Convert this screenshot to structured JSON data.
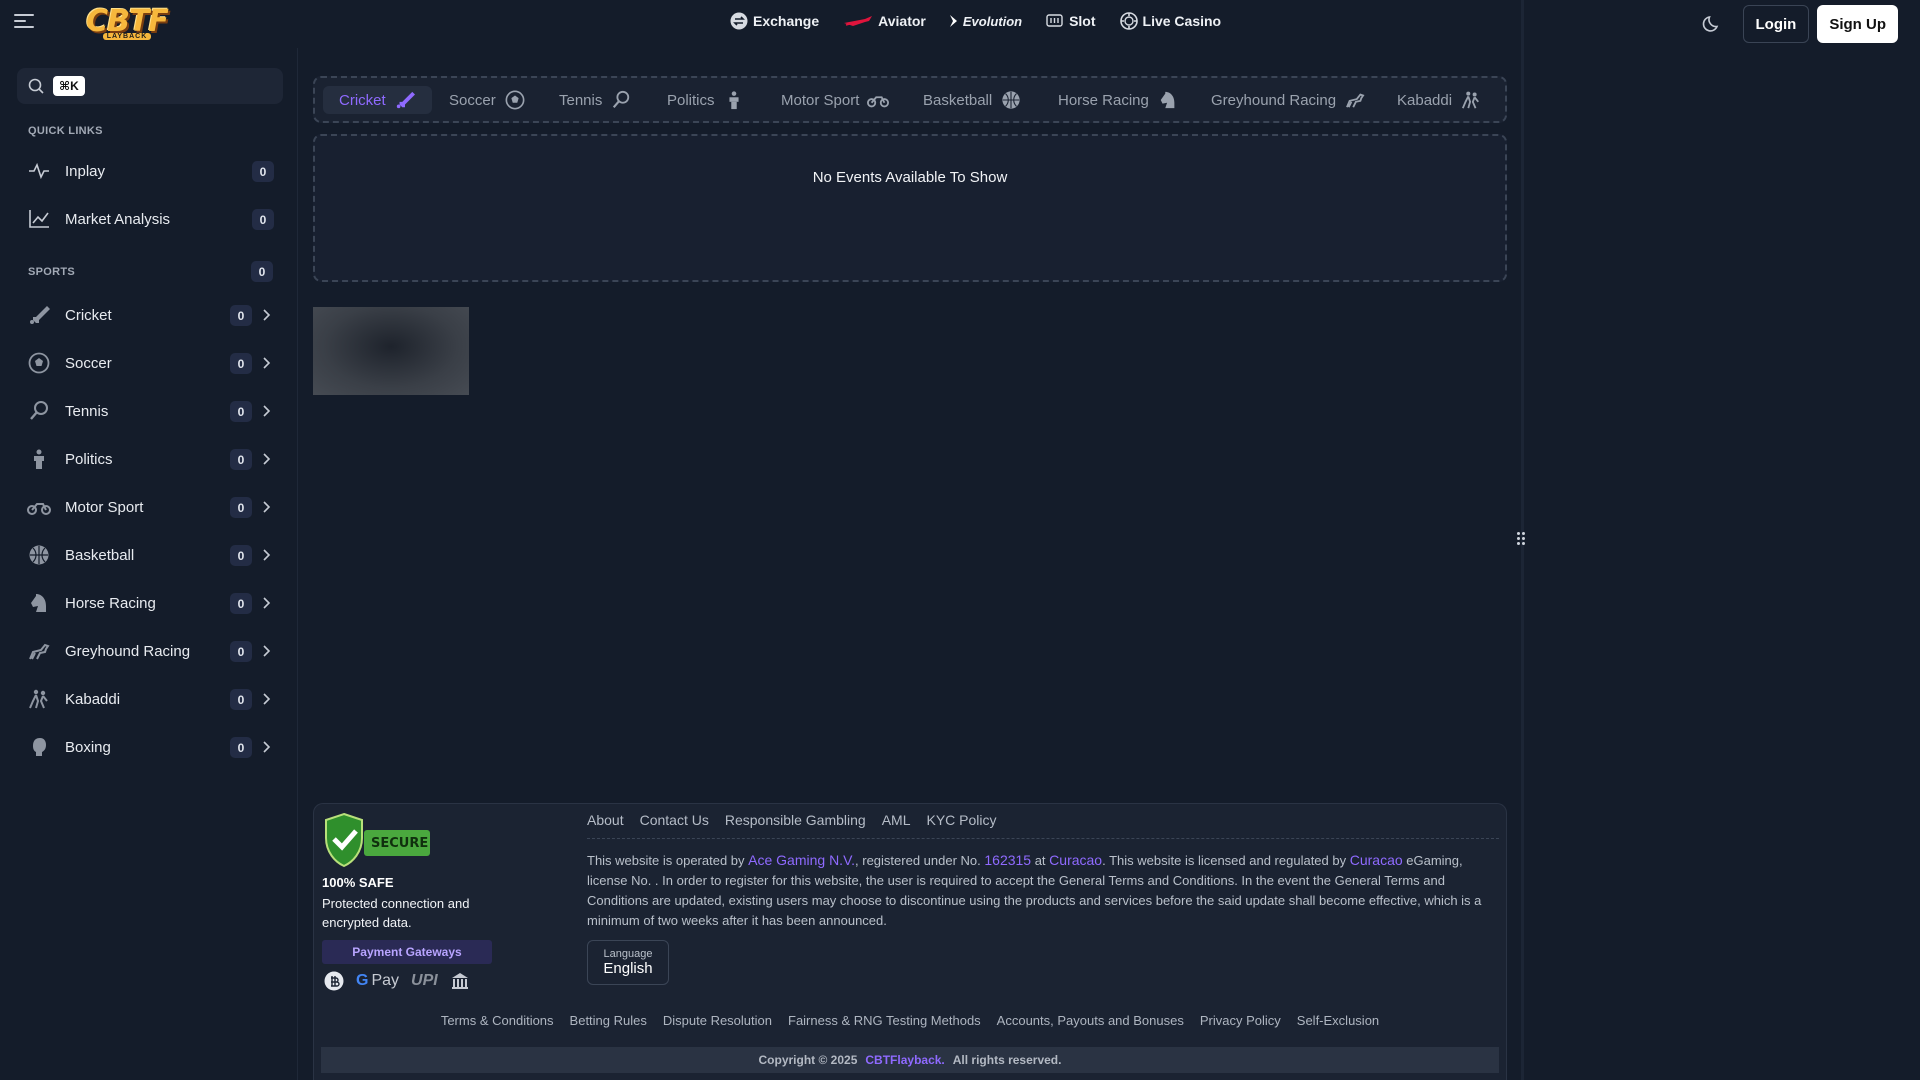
{
  "header": {
    "logo_text": "CBTF",
    "logo_sub": "LAYBACK",
    "nav": [
      {
        "label": "Exchange",
        "icon": "exchange-icon"
      },
      {
        "label": "Aviator",
        "icon": "aviator-plane-icon"
      },
      {
        "label": "Evolution",
        "icon": "evolution-icon"
      },
      {
        "label": "Slot",
        "icon": "slot-machine-icon"
      },
      {
        "label": "Live Casino",
        "icon": "casino-chip-icon"
      }
    ],
    "login_label": "Login",
    "signup_label": "Sign Up"
  },
  "sidebar": {
    "search_shortcut": "⌘K",
    "search_placeholder": "",
    "quick_links_label": "QUICK LINKS",
    "quick_links": [
      {
        "label": "Inplay",
        "count": "0",
        "icon": "pulse-icon"
      },
      {
        "label": "Market Analysis",
        "count": "0",
        "icon": "chart-line-icon"
      }
    ],
    "sports_label": "SPORTS",
    "sports_count": "0",
    "sports": [
      {
        "label": "Cricket",
        "count": "0",
        "icon": "cricket-bat-icon"
      },
      {
        "label": "Soccer",
        "count": "0",
        "icon": "soccer-ball-icon"
      },
      {
        "label": "Tennis",
        "count": "0",
        "icon": "tennis-racket-icon"
      },
      {
        "label": "Politics",
        "count": "0",
        "icon": "politics-podium-icon"
      },
      {
        "label": "Motor Sport",
        "count": "0",
        "icon": "motorbike-icon"
      },
      {
        "label": "Basketball",
        "count": "0",
        "icon": "basketball-icon"
      },
      {
        "label": "Horse Racing",
        "count": "0",
        "icon": "horse-head-icon"
      },
      {
        "label": "Greyhound Racing",
        "count": "0",
        "icon": "greyhound-icon"
      },
      {
        "label": "Kabaddi",
        "count": "0",
        "icon": "kabaddi-players-icon"
      },
      {
        "label": "Boxing",
        "count": "0",
        "icon": "boxing-glove-icon"
      }
    ]
  },
  "main": {
    "tabs": [
      {
        "label": "Cricket",
        "active": true
      },
      {
        "label": "Soccer"
      },
      {
        "label": "Tennis"
      },
      {
        "label": "Politics"
      },
      {
        "label": "Motor Sport"
      },
      {
        "label": "Basketball"
      },
      {
        "label": "Horse Racing"
      },
      {
        "label": "Greyhound Racing"
      },
      {
        "label": "Kabaddi"
      }
    ],
    "no_events_message": "No Events Available To Show"
  },
  "footer": {
    "secure_badge_text": "SECURE",
    "safe_title": "100% SAFE",
    "safe_desc": "Protected connection and encrypted data.",
    "payment_gateways_label": "Payment Gateways",
    "payment_methods": [
      "crypto-icon",
      "G Pay",
      "UPI",
      "bank-icon"
    ],
    "links": [
      "About",
      "Contact Us",
      "Responsible Gambling",
      "AML",
      "KYC Policy"
    ],
    "legal": {
      "p1": "This website is operated by ",
      "company": "Ace Gaming N.V.",
      "p2": ", registered under No. ",
      "reg_no": "162315",
      "p3": " at ",
      "location": "Curacao",
      "p4": ". This website is licensed and regulated by ",
      "regulator": "Curacao",
      "p5": " eGaming, license No. . In order to register for this website, the user is required to accept the General Terms and Conditions. In the event the General Terms and Conditions are updated, existing users may choose to discontinue using the products and services before the said update shall become effective, which is a minimum of two weeks after it has been announced."
    },
    "language_label": "Language",
    "language_value": "English",
    "bottom_links": [
      "Terms & Conditions",
      "Betting Rules",
      "Dispute Resolution",
      "Fairness & RNG Testing Methods",
      "Accounts, Payouts and Bonuses",
      "Privacy Policy",
      "Self-Exclusion"
    ],
    "copyright": "Copyright © 2025",
    "brand": "CBTFlayback.",
    "rights": "All rights reserved."
  },
  "colors": {
    "background": "#141c2a",
    "accent": "#8f6aff",
    "badge": "#232c45"
  }
}
